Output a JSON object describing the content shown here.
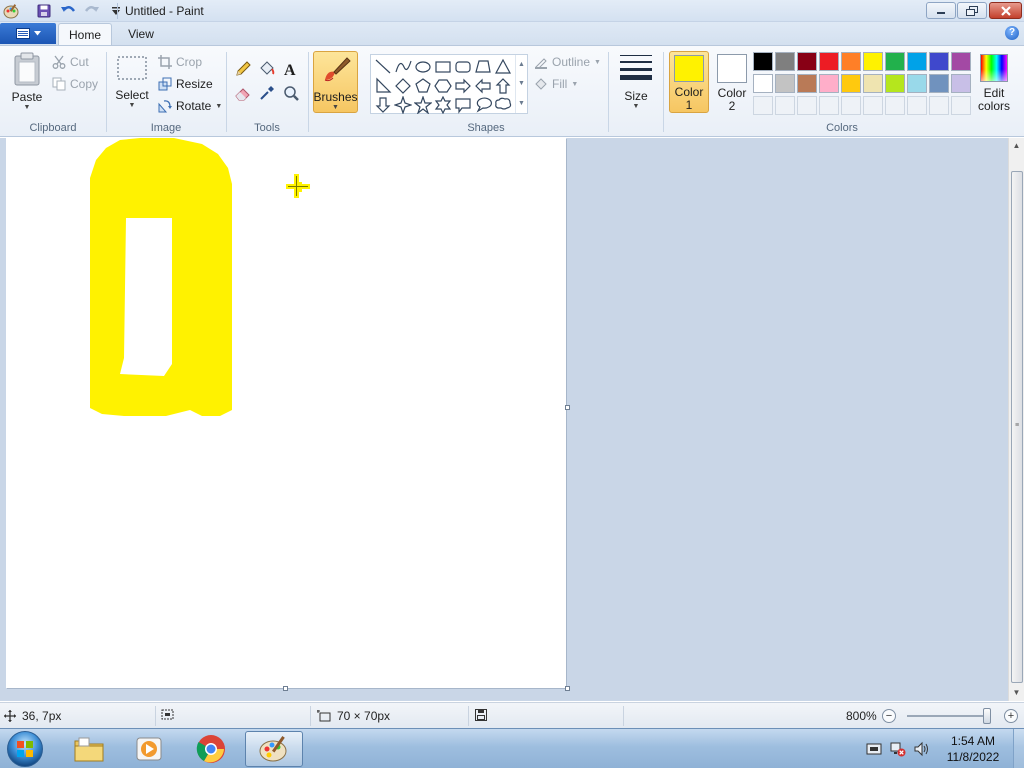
{
  "window": {
    "title": "Untitled - Paint",
    "buttons": {
      "minimize": "minimize",
      "maximize": "restore",
      "close": "close"
    }
  },
  "tabs": [
    {
      "label": "Home",
      "active": true
    },
    {
      "label": "View",
      "active": false
    }
  ],
  "ribbon": {
    "clipboard": {
      "group_label": "Clipboard",
      "paste": "Paste",
      "cut": "Cut",
      "copy": "Copy"
    },
    "image": {
      "group_label": "Image",
      "select": "Select",
      "crop": "Crop",
      "resize": "Resize",
      "rotate": "Rotate"
    },
    "tools": {
      "group_label": "Tools",
      "items": [
        "pencil-icon",
        "fill-bucket-icon",
        "text-icon",
        "eraser-icon",
        "color-picker-icon",
        "magnifier-icon"
      ]
    },
    "brushes": {
      "label": "Brushes"
    },
    "shapes": {
      "group_label": "Shapes",
      "outline": "Outline",
      "fill": "Fill",
      "items": [
        "line",
        "curve",
        "oval",
        "rectangle",
        "rounded-rectangle",
        "polygon",
        "triangle",
        "right-triangle",
        "diamond",
        "pentagon",
        "hexagon",
        "right-arrow",
        "left-arrow",
        "up-arrow",
        "down-arrow",
        "four-point-star",
        "five-point-star",
        "six-point-star",
        "rounded-callout",
        "oval-callout",
        "cloud-callout"
      ]
    },
    "size": {
      "label": "Size"
    },
    "colors": {
      "group_label": "Colors",
      "color1": {
        "line1": "Color",
        "line2": "1",
        "value": "#fff200"
      },
      "color2": {
        "line1": "Color",
        "line2": "2",
        "value": "#ffffff"
      },
      "edit_line1": "Edit",
      "edit_line2": "colors",
      "palette_row1": [
        "#000000",
        "#7f7f7f",
        "#880015",
        "#ed1c24",
        "#ff7f27",
        "#fff200",
        "#22b14c",
        "#00a2e8",
        "#3f48cc",
        "#a349a4"
      ],
      "palette_row2": [
        "#ffffff",
        "#c3c3c3",
        "#b97a57",
        "#ffaec9",
        "#ffc90e",
        "#efe4b0",
        "#b5e61d",
        "#99d9ea",
        "#7092be",
        "#c8bfe7"
      ]
    }
  },
  "statusbar": {
    "cursor_pos": "36, 7px",
    "selection_size": "",
    "image_size": "70 × 70px",
    "file_size": "",
    "zoom": "800%"
  },
  "taskbar": {
    "apps": [
      "windows-explorer",
      "media-player",
      "google-chrome",
      "paint"
    ],
    "clock_time": "1:54 AM",
    "clock_date": "11/8/2022"
  }
}
